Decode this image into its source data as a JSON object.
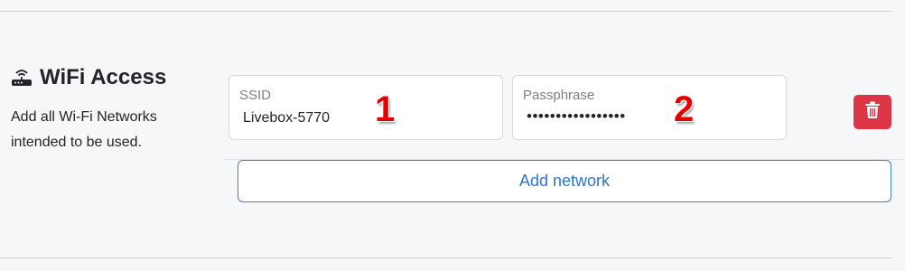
{
  "section": {
    "title": "WiFi Access",
    "icon": "router-icon",
    "description": "Add all Wi-Fi Networks intended to be used."
  },
  "network": {
    "ssid_label": "SSID",
    "ssid_value": "Livebox-5770",
    "passphrase_label": "Passphrase",
    "passphrase_value": "•••••••••••••••••",
    "delete_icon": "trash-icon"
  },
  "markers": {
    "one": "1",
    "two": "2"
  },
  "actions": {
    "add_network_label": "Add network"
  },
  "colors": {
    "background": "#f6f7f9",
    "danger": "#dc3545",
    "primary": "#2f74d0",
    "marker": "#e60000"
  }
}
